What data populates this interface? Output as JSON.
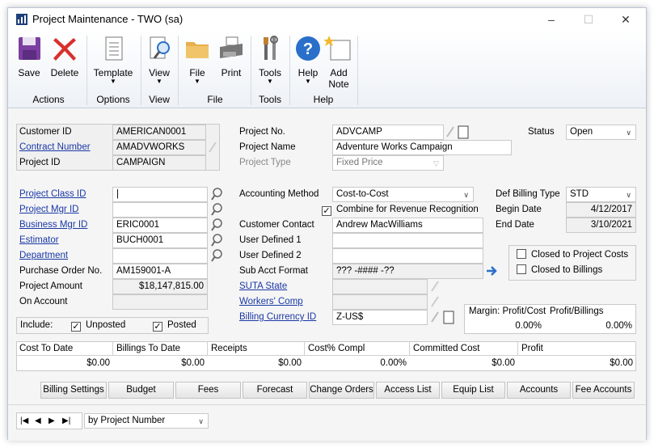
{
  "window": {
    "title": "Project Maintenance  -  TWO (sa)",
    "minimize": "–",
    "maximize": "☐",
    "close": "✕"
  },
  "ribbon": {
    "save": "Save",
    "delete": "Delete",
    "template": "Template",
    "view": "View",
    "file": "File",
    "print": "Print",
    "tools": "Tools",
    "help": "Help",
    "add_note_1": "Add",
    "add_note_2": "Note",
    "groups": {
      "actions": "Actions",
      "options": "Options",
      "view": "View",
      "file": "File",
      "tools": "Tools",
      "help": "Help"
    }
  },
  "header": {
    "customer_id_label": "Customer ID",
    "customer_id": "AMERICAN0001",
    "contract_number_label": "Contract Number",
    "contract_number": "AMADVWORKS",
    "project_id_label": "Project ID",
    "project_id": "CAMPAIGN",
    "project_no_label": "Project No.",
    "project_no": "ADVCAMP",
    "project_name_label": "Project Name",
    "project_name": "Adventure Works Campaign",
    "project_type_label": "Project Type",
    "project_type": "Fixed Price",
    "status_label": "Status",
    "status": "Open"
  },
  "left": {
    "project_class_label": "Project Class ID",
    "project_class": "|",
    "project_mgr_label": "Project Mgr ID",
    "project_mgr": "",
    "business_mgr_label": "Business Mgr ID",
    "business_mgr": "ERIC0001",
    "estimator_label": "Estimator",
    "estimator": "BUCH0001",
    "department_label": "Department",
    "department": "",
    "po_label": "Purchase Order No.",
    "po": "AM159001-A",
    "amount_label": "Project Amount",
    "amount": "$18,147,815.00",
    "on_account_label": "On Account",
    "on_account": "",
    "include_label": "Include:",
    "unposted": "Unposted",
    "posted": "Posted"
  },
  "middle": {
    "accounting_method_label": "Accounting Method",
    "accounting_method": "Cost-to-Cost",
    "combine_label": "Combine for Revenue Recognition",
    "customer_contact_label": "Customer Contact",
    "customer_contact": "Andrew MacWilliams",
    "ud1_label": "User Defined 1",
    "ud1": "",
    "ud2_label": "User Defined 2",
    "ud2": "",
    "sub_acct_label": "Sub Acct Format",
    "sub_acct": "??? -#### -??",
    "suta_label": "SUTA State",
    "suta": "",
    "workers_comp_label": "Workers' Comp",
    "workers_comp": "",
    "billing_currency_label": "Billing Currency ID",
    "billing_currency": "Z-US$"
  },
  "right": {
    "def_billing_label": "Def Billing Type",
    "def_billing": "STD",
    "begin_date_label": "Begin Date",
    "begin_date": "4/12/2017",
    "end_date_label": "End Date",
    "end_date": "3/10/2021",
    "closed_costs": "Closed to Project Costs",
    "closed_billings": "Closed to Billings",
    "margin_label": "Margin: Profit/Cost",
    "margin": "0.00%",
    "profit_billings_label": "Profit/Billings",
    "profit_billings": "0.00%"
  },
  "totals": {
    "headers": [
      "Cost To Date",
      "Billings To Date",
      "Receipts",
      "Cost% Compl",
      "Committed Cost",
      "Profit"
    ],
    "values": [
      "$0.00",
      "$0.00",
      "$0.00",
      "0.00%",
      "$0.00",
      "$0.00"
    ]
  },
  "buttons": [
    "Billing Settings",
    "Budget",
    "Fees",
    "Forecast",
    "Change Orders",
    "Access List",
    "Equip List",
    "Accounts",
    "Fee Accounts"
  ],
  "footer": {
    "nav_first": "|◀",
    "nav_prev": "◀",
    "nav_next": "▶",
    "nav_last": "▶|",
    "sort_by": "by Project Number"
  },
  "colors": {
    "accent": "#1a38a6",
    "ribbon_blue": "#2a6fc9"
  }
}
